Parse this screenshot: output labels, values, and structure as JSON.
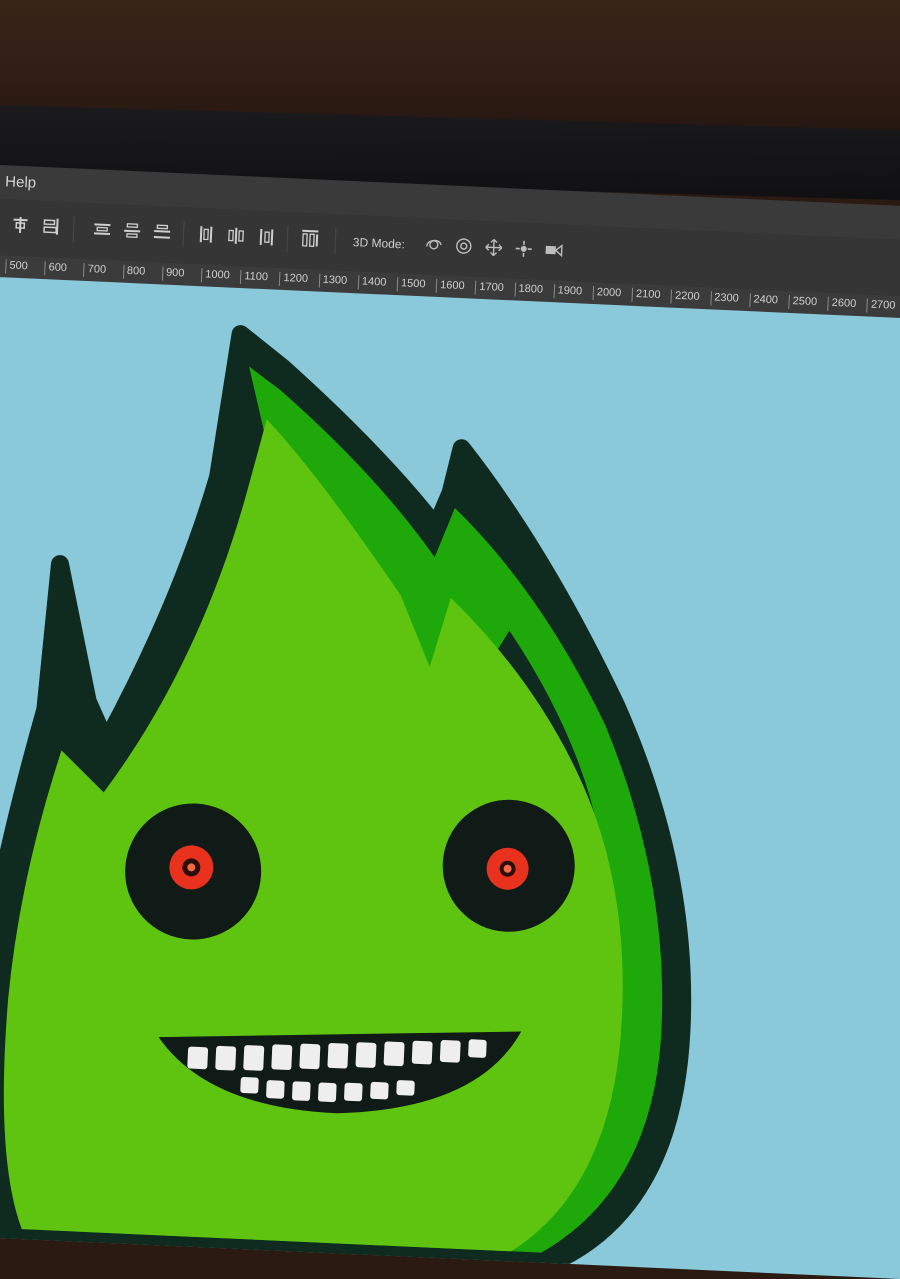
{
  "menubar": {
    "help_label": "Help"
  },
  "options_bar": {
    "mode_label": "3D Mode:",
    "align_tools": [
      "align-top-icon",
      "align-vcenter-icon",
      "align-bottom-icon"
    ],
    "distribute_tools": [
      "distribute-top-icon",
      "distribute-vcenter-icon",
      "distribute-bottom-icon",
      "distribute-left-icon",
      "distribute-hcenter-icon",
      "distribute-right-icon"
    ],
    "mode_tools": [
      "orbit-3d-icon",
      "roll-3d-icon",
      "pan-3d-icon",
      "slide-3d-icon",
      "scale-3d-icon"
    ]
  },
  "ruler": {
    "ticks": [
      "500",
      "600",
      "700",
      "800",
      "900",
      "1000",
      "1100",
      "1200",
      "1300",
      "1400",
      "1500",
      "1600",
      "1700",
      "1800",
      "1900",
      "2000",
      "2100",
      "2200",
      "2300",
      "2400",
      "2500",
      "2600",
      "2700"
    ]
  },
  "canvas": {
    "background": "#8ac9d9",
    "character": {
      "body_color": "#5ec40f",
      "shadow_color": "#1ea80a",
      "outline_color": "#0f2a1e",
      "eye_color": "#e8321e"
    }
  }
}
